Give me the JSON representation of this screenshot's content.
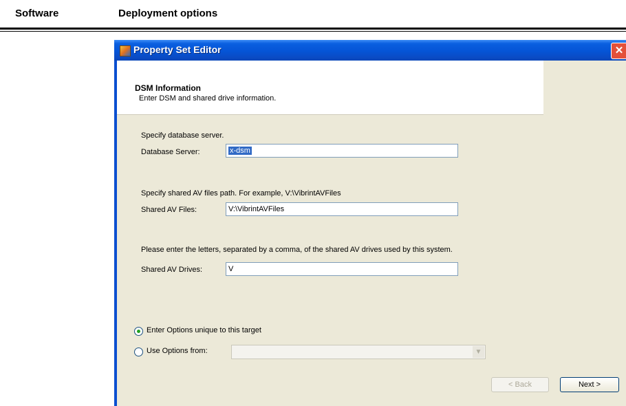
{
  "document": {
    "section": "Software",
    "title": "Deployment options"
  },
  "window": {
    "title": "Property Set Editor",
    "close_glyph": "✕"
  },
  "header": {
    "title": "DSM Information",
    "subtitle": "Enter DSM and shared drive information."
  },
  "form": {
    "db_prompt": "Specify database server.",
    "db_label": "Database Server:",
    "db_value": "x-dsm",
    "av_files_prompt": "Specify shared AV files path.  For example, V:\\VibrintAVFiles",
    "av_files_label": "Shared AV Files:",
    "av_files_value": "V:\\VibrintAVFiles",
    "av_drives_prompt": "Please enter the letters, separated by a comma, of the shared AV drives used by this system.",
    "av_drives_label": "Shared AV Drives:",
    "av_drives_value": "V"
  },
  "options": {
    "unique_label": "Enter Options unique to this target",
    "use_from_label": "Use Options from:",
    "selected": "unique",
    "use_from_value": ""
  },
  "buttons": {
    "back": "< Back",
    "next": "Next >"
  },
  "colors": {
    "titlebar": "#0554d6",
    "panel": "#ece9d8",
    "selection": "#316ac5",
    "close": "#e4503a"
  }
}
